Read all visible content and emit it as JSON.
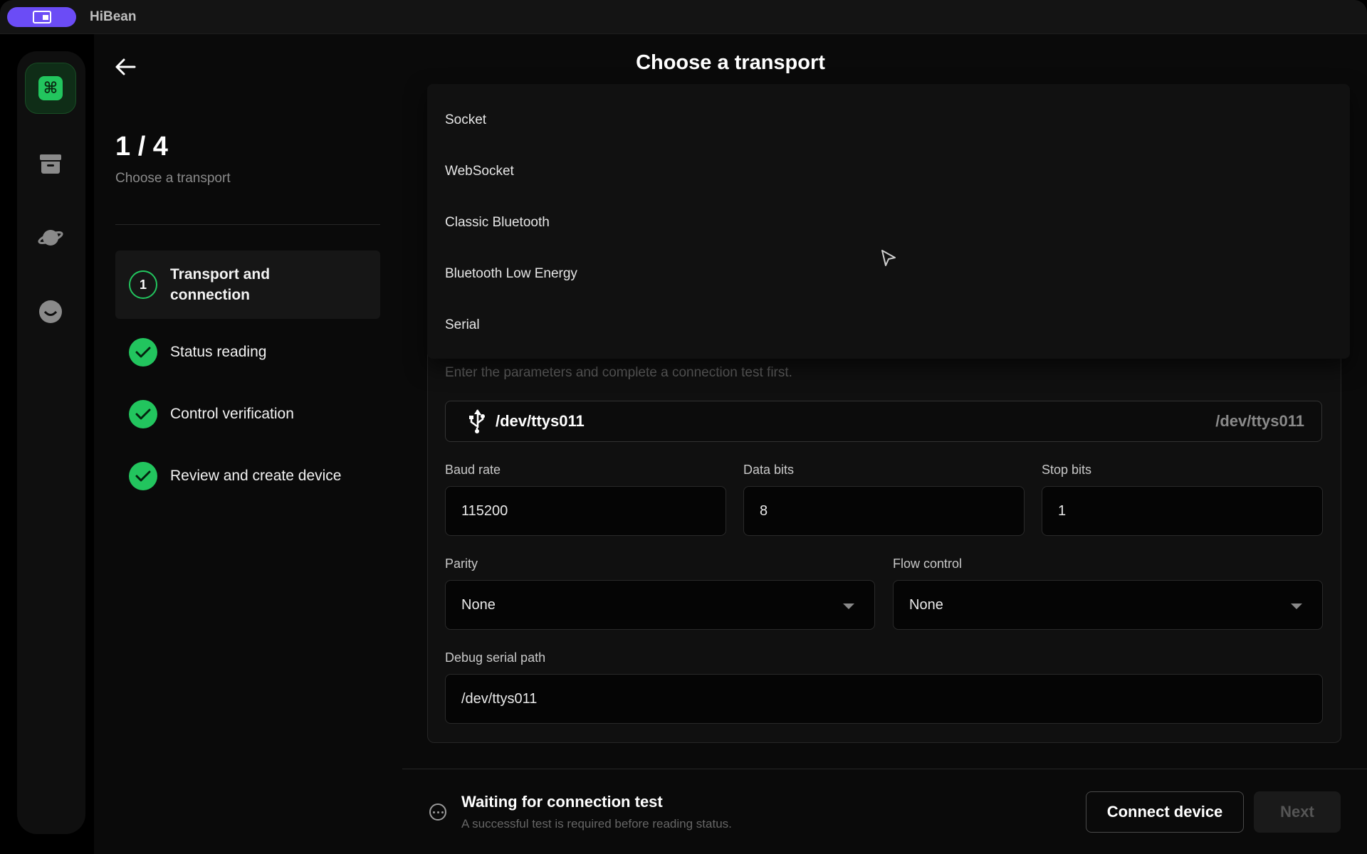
{
  "app": {
    "name": "HiBean"
  },
  "header": {
    "title": "Choose a transport"
  },
  "steps": {
    "count": "1 / 4",
    "subtitle": "Choose a transport",
    "items": [
      {
        "number": "1",
        "label": "Transport and connection",
        "state": "active"
      },
      {
        "label": "Status reading",
        "state": "done"
      },
      {
        "label": "Control verification",
        "state": "done"
      },
      {
        "label": "Review and create device",
        "state": "done"
      }
    ]
  },
  "transport_menu": {
    "options": [
      "Socket",
      "WebSocket",
      "Classic Bluetooth",
      "Bluetooth Low Energy",
      "Serial"
    ]
  },
  "form": {
    "hint": "Enter the parameters and complete a connection test first.",
    "port": {
      "value": "/dev/ttys011",
      "right_value": "/dev/ttys011"
    },
    "baud_rate": {
      "label": "Baud rate",
      "value": "115200"
    },
    "data_bits": {
      "label": "Data bits",
      "value": "8"
    },
    "stop_bits": {
      "label": "Stop bits",
      "value": "1"
    },
    "parity": {
      "label": "Parity",
      "value": "None"
    },
    "flow_control": {
      "label": "Flow control",
      "value": "None"
    },
    "debug_path": {
      "label": "Debug serial path",
      "value": "/dev/ttys011"
    }
  },
  "footer": {
    "status_title": "Waiting for connection test",
    "status_sub": "A successful test is required before reading status.",
    "connect_label": "Connect device",
    "next_label": "Next"
  },
  "colors": {
    "accent": "#22c55e",
    "brand": "#6b4cf6",
    "background": "#0a0a0a"
  },
  "icons": [
    "app-window-icon",
    "command-icon",
    "archive-icon",
    "planet-icon",
    "smile-icon",
    "back-arrow-icon",
    "usb-icon",
    "check-icon",
    "more-icon",
    "cursor-icon"
  ]
}
